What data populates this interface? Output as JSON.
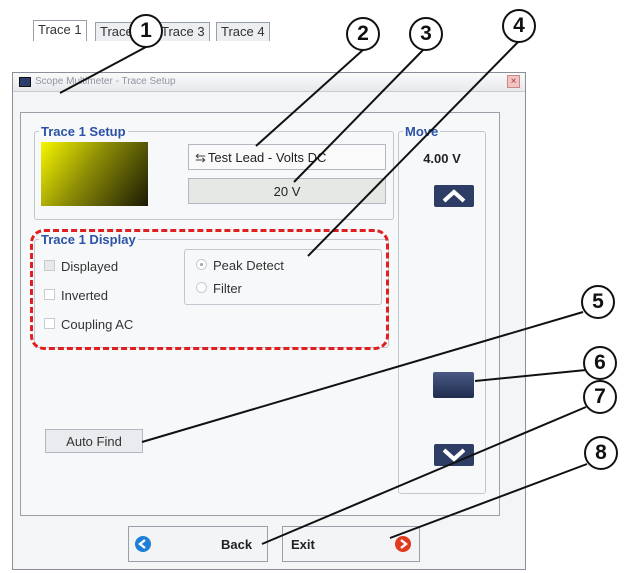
{
  "window": {
    "title": "Scope Multimeter - Trace Setup",
    "close": "×"
  },
  "tabs": [
    {
      "label": "Trace 1",
      "active": true
    },
    {
      "label": "Trace 2",
      "active": false
    },
    {
      "label": "Trace 3",
      "active": false
    },
    {
      "label": "Trace 4",
      "active": false
    }
  ],
  "setup": {
    "legend": "Trace 1 Setup",
    "trace_color_gradient": [
      "#f6f600",
      "#1a1a05"
    ],
    "lead_icon": "probe-icon",
    "lead_label": "Test Lead - Volts DC",
    "scale_label": "20 V"
  },
  "display": {
    "legend": "Trace 1 Display",
    "checkboxes": [
      {
        "label": "Displayed",
        "checked": true
      },
      {
        "label": "Inverted",
        "checked": false
      },
      {
        "label": "Coupling AC",
        "checked": false
      }
    ],
    "radios": [
      {
        "label": "Peak Detect",
        "selected": true
      },
      {
        "label": "Filter",
        "selected": false
      }
    ],
    "highlight_color": "#e02020"
  },
  "auto_find_label": "Auto Find",
  "move": {
    "legend": "Move",
    "value": "4.00 V",
    "up_icon": "chevron-up-icon",
    "down_icon": "chevron-down-icon",
    "thumb_color": "#2d3d66"
  },
  "buttons": {
    "back_label": "Back",
    "back_icon": "arrow-left-icon",
    "back_color": "#1e7fd6",
    "exit_label": "Exit",
    "exit_icon": "arrow-right-icon",
    "exit_color": "#e03a20"
  },
  "callouts": [
    "1",
    "2",
    "3",
    "4",
    "5",
    "6",
    "7",
    "8"
  ]
}
